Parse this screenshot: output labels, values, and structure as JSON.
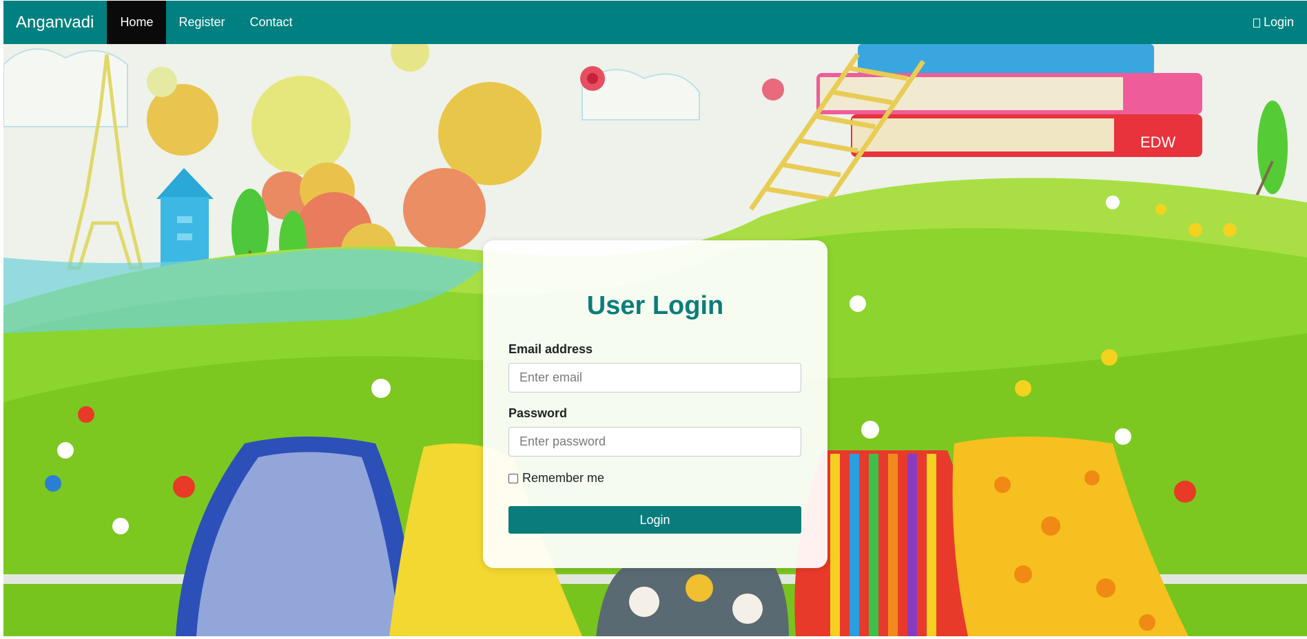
{
  "navbar": {
    "brand": "Anganvadi",
    "links": [
      {
        "label": "Home",
        "active": true
      },
      {
        "label": "Register",
        "active": false
      },
      {
        "label": "Contact",
        "active": false
      }
    ],
    "login_icon": "sign-in-icon",
    "login_label": "Login",
    "color": "#008080"
  },
  "background": {
    "book_label": "EDW"
  },
  "login_form": {
    "title": "User Login",
    "email_label": "Email address",
    "email_placeholder": "Enter email",
    "password_label": "Password",
    "password_placeholder": "Enter password",
    "remember_label": "Remember me",
    "submit_label": "Login",
    "accent_color": "#0b7c7c"
  }
}
